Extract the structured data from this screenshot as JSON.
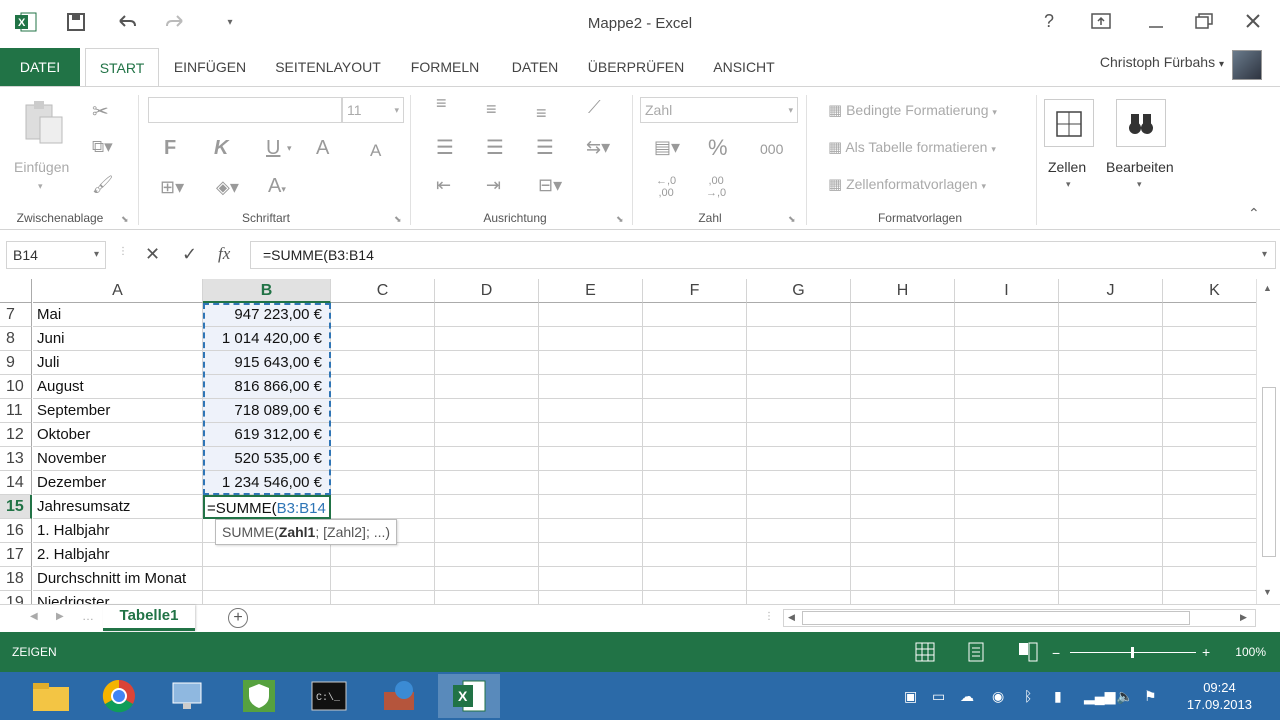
{
  "window": {
    "title": "Mappe2 - Excel"
  },
  "ribbon_tabs": [
    "DATEI",
    "START",
    "EINFÜGEN",
    "SEITENLAYOUT",
    "FORMELN",
    "DATEN",
    "ÜBERPRÜFEN",
    "ANSICHT"
  ],
  "user": {
    "name": "Christoph Fürbahs"
  },
  "ribbon": {
    "clipboard": {
      "paste_label": "Einfügen",
      "group_label": "Zwischenablage"
    },
    "font": {
      "font_name": "",
      "font_size": "11",
      "bold": "F",
      "italic": "K",
      "underline": "U",
      "grow": "A",
      "shrink": "A",
      "font_color": "A",
      "group_label": "Schriftart"
    },
    "alignment": {
      "group_label": "Ausrichtung"
    },
    "number": {
      "format": "Zahl",
      "percent": "%",
      "thousands": "000",
      "inc_dec": "€,0\n,00",
      "dec_dec": ",00\n→,0",
      "group_label": "Zahl"
    },
    "styles": {
      "conditional": "Bedingte Formatierung",
      "as_table": "Als Tabelle formatieren",
      "cell_styles": "Zellenformatvorlagen",
      "group_label": "Formatvorlagen"
    },
    "cells": {
      "label": "Zellen"
    },
    "editing": {
      "label": "Bearbeiten"
    }
  },
  "formula_bar": {
    "name_box": "B14",
    "formula": "=SUMME(B3:B14",
    "fx": "fx"
  },
  "columns": [
    "A",
    "B",
    "C",
    "D",
    "E",
    "F",
    "G",
    "H",
    "I",
    "J",
    "K"
  ],
  "rows": [
    {
      "num": "7",
      "a": "Mai",
      "b": "947 223,00 €"
    },
    {
      "num": "8",
      "a": "Juni",
      "b": "1 014 420,00 €"
    },
    {
      "num": "9",
      "a": "Juli",
      "b": "915 643,00 €"
    },
    {
      "num": "10",
      "a": "August",
      "b": "816 866,00 €"
    },
    {
      "num": "11",
      "a": "September",
      "b": "718 089,00 €"
    },
    {
      "num": "12",
      "a": "Oktober",
      "b": "619 312,00 €"
    },
    {
      "num": "13",
      "a": "November",
      "b": "520 535,00 €"
    },
    {
      "num": "14",
      "a": "Dezember",
      "b": "1 234 546,00 €"
    },
    {
      "num": "15",
      "a": "Jahresumsatz",
      "b": ""
    },
    {
      "num": "16",
      "a": "1. Halbjahr",
      "b": ""
    },
    {
      "num": "17",
      "a": "2. Halbjahr",
      "b": ""
    },
    {
      "num": "18",
      "a": "Durchschnitt im Monat",
      "b": ""
    },
    {
      "num": "19",
      "a": "Niedrigster",
      "b": ""
    }
  ],
  "editing_cell": {
    "prefix": "=SUMME(",
    "ref": "B3:B14"
  },
  "tooltip": {
    "fn": "SUMME(",
    "arg1": "Zahl1",
    "rest": "; [Zahl2]; ...)"
  },
  "sheet": {
    "tab": "Tabelle1"
  },
  "status": {
    "mode": "ZEIGEN",
    "zoom": "100%"
  },
  "taskbar": {
    "time": "09:24",
    "date": "17.09.2013"
  },
  "colors": {
    "accent": "#217346",
    "ref": "#2e75b6"
  }
}
